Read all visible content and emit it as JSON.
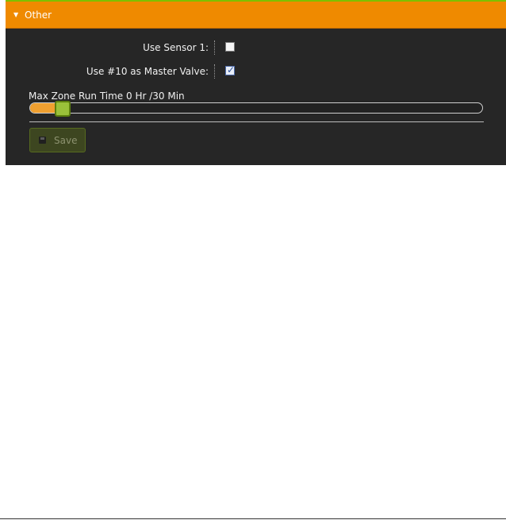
{
  "section": {
    "title": "Other",
    "expanded": true
  },
  "settings": [
    {
      "label": "Use Sensor 1:",
      "checked": false
    },
    {
      "label": "Use #10 as Master Valve:",
      "checked": true
    }
  ],
  "slider": {
    "label": "Max Zone Run Time 0 Hr /30 Min",
    "value_fraction": 0.04
  },
  "save": {
    "label": "Save"
  },
  "colors": {
    "header": "#ef8a00",
    "panel": "#262626",
    "slider_fill": "#f0a030",
    "slider_handle": "#9ac13a"
  }
}
